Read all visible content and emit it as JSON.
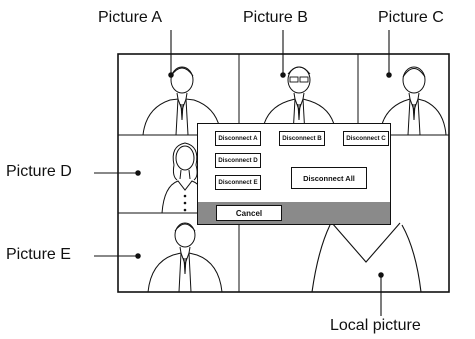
{
  "callouts": {
    "picture_a": "Picture A",
    "picture_b": "Picture B",
    "picture_c": "Picture C",
    "picture_d": "Picture D",
    "picture_e": "Picture E",
    "local": "Local picture"
  },
  "dialog": {
    "disconnect_a": "Disconnect A",
    "disconnect_b": "Disconnect B",
    "disconnect_c": "Disconnect C",
    "disconnect_d": "Disconnect D",
    "disconnect_e": "Disconnect E",
    "disconnect_all": "Disconnect All",
    "cancel": "Cancel"
  },
  "colors": {
    "line": "#111111",
    "footer": "#8a8a8a"
  }
}
